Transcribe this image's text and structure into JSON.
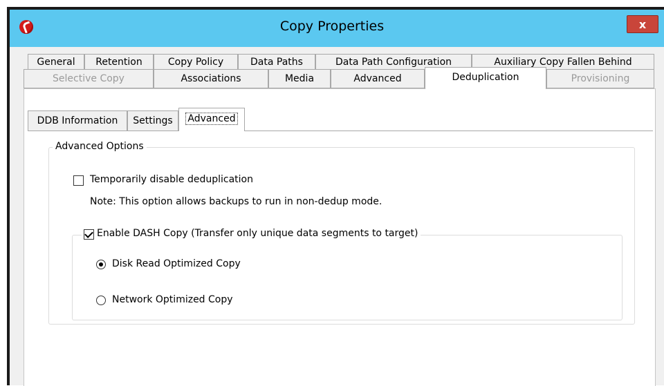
{
  "window": {
    "title": "Copy Properties",
    "close_label": "x",
    "titlebar_color": "#5bc8f0",
    "close_color": "#c9453a"
  },
  "tabs_row1": [
    "General",
    "Retention",
    "Copy Policy",
    "Data Paths",
    "Data Path Configuration",
    "Auxiliary Copy Fallen Behind"
  ],
  "tabs_row2": [
    "Selective Copy",
    "Associations",
    "Media",
    "Advanced",
    "Deduplication",
    "Provisioning"
  ],
  "active_tab": "Deduplication",
  "subtabs": [
    "DDB Information",
    "Settings",
    "Advanced"
  ],
  "active_subtab": "Advanced",
  "advanced_options": {
    "group_label": "Advanced Options",
    "disable_dedup": {
      "label": "Temporarily disable deduplication",
      "checked": false
    },
    "note": "Note: This option allows backups to run in non-dedup mode.",
    "dash_copy": {
      "label": "Enable DASH Copy (Transfer only unique data segments to target)",
      "checked": true,
      "options": [
        {
          "label": "Disk Read Optimized Copy",
          "selected": true
        },
        {
          "label": "Network Optimized Copy",
          "selected": false
        }
      ]
    }
  }
}
